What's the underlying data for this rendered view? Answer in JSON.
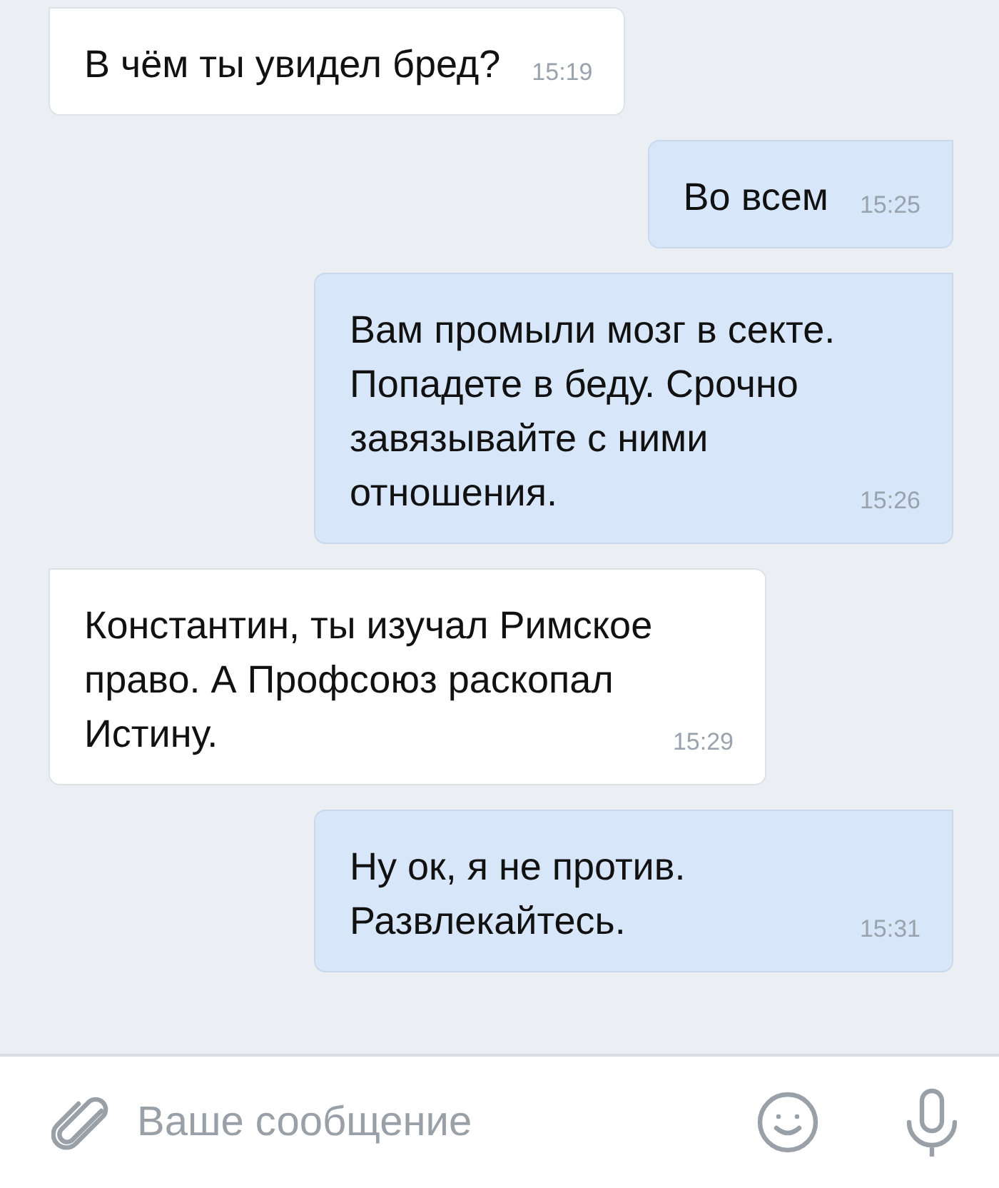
{
  "messages": [
    {
      "kind": "incoming",
      "text": "В чём ты увидел бред?",
      "time": "15:19"
    },
    {
      "kind": "outgoing",
      "text": "Во всем",
      "time": "15:25"
    },
    {
      "kind": "outgoing",
      "text": "Вам промыли мозг в секте. Попадете в беду. Срочно завязывайте с ними отношения.",
      "time": "15:26"
    },
    {
      "kind": "incoming",
      "text": "Константин, ты изучал Римское право. А Профсоюз раскопал Истину.",
      "time": "15:29"
    },
    {
      "kind": "outgoing",
      "text": "Ну ок, я не против. Развлекайтесь.",
      "time": "15:31"
    }
  ],
  "composer": {
    "placeholder": "Ваше сообщение"
  }
}
